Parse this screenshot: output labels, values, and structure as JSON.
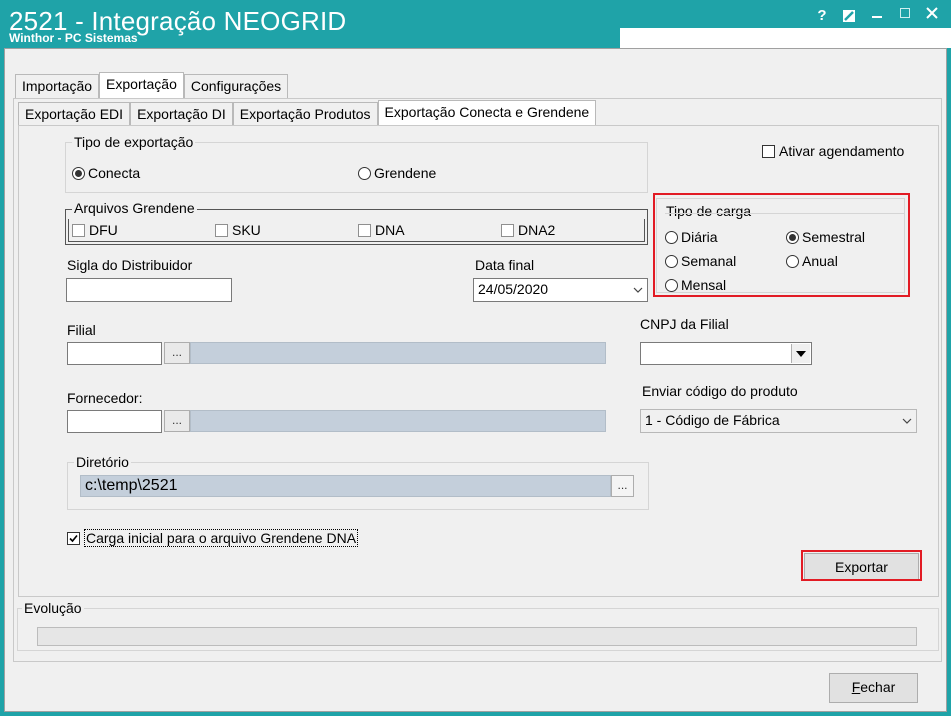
{
  "window": {
    "title": "2521 - Integração NEOGRID",
    "subtitle": "Winthor - PC Sistemas",
    "controls": {
      "help": "?",
      "edit": "✎",
      "minimize": "—",
      "maximize": "☐",
      "close": "✕"
    },
    "colors": {
      "titlebar": "#1fa3a8",
      "highlight": "#e21b24"
    }
  },
  "tabs": [
    {
      "label": "Importação"
    },
    {
      "label": "Exportação"
    },
    {
      "label": "Configurações"
    }
  ],
  "subtabs": [
    {
      "label": "Exportação EDI"
    },
    {
      "label": "Exportação DI"
    },
    {
      "label": "Exportação Produtos"
    },
    {
      "label": "Exportação Conecta e Grendene"
    }
  ],
  "tipo_exportacao": {
    "legend": "Tipo de exportação",
    "options": [
      {
        "label": "Conecta",
        "selected": true
      },
      {
        "label": "Grendene",
        "selected": false
      }
    ]
  },
  "agendamento": {
    "label": "Ativar agendamento",
    "checked": false
  },
  "arquivos_grendene": {
    "legend": "Arquivos Grendene",
    "items": [
      {
        "label": "DFU",
        "checked": false
      },
      {
        "label": "SKU",
        "checked": false
      },
      {
        "label": "DNA",
        "checked": false
      },
      {
        "label": "DNA2",
        "checked": false
      }
    ]
  },
  "tipo_carga": {
    "legend": "Tipo de carga",
    "options": [
      {
        "label": "Diária",
        "selected": false
      },
      {
        "label": "Semestral",
        "selected": true
      },
      {
        "label": "Semanal",
        "selected": false
      },
      {
        "label": "Anual",
        "selected": false
      },
      {
        "label": "Mensal",
        "selected": false
      }
    ]
  },
  "sigla": {
    "label": "Sigla do Distribuidor",
    "value": ""
  },
  "data_final": {
    "label": "Data final",
    "value": "24/05/2020"
  },
  "filial": {
    "label": "Filial",
    "code": "",
    "description": "",
    "button": "..."
  },
  "cnpj": {
    "label": "CNPJ da Filial",
    "value": ""
  },
  "fornecedor": {
    "label": "Fornecedor:",
    "code": "",
    "description": "",
    "button": "..."
  },
  "enviar_codigo": {
    "label": "Enviar código do produto",
    "value": "1 - Código de Fábrica"
  },
  "diretorio": {
    "legend": "Diretório",
    "value": "c:\\temp\\2521",
    "button": "..."
  },
  "carga_inicial": {
    "label": "Carga inicial para o arquivo Grendene DNA",
    "checked": true
  },
  "exportar": {
    "label": "Exportar"
  },
  "evolucao": {
    "legend": "Evolução",
    "progress": 0
  },
  "fechar": {
    "label": "Fechar",
    "accel": "F",
    "rest": "echar"
  }
}
